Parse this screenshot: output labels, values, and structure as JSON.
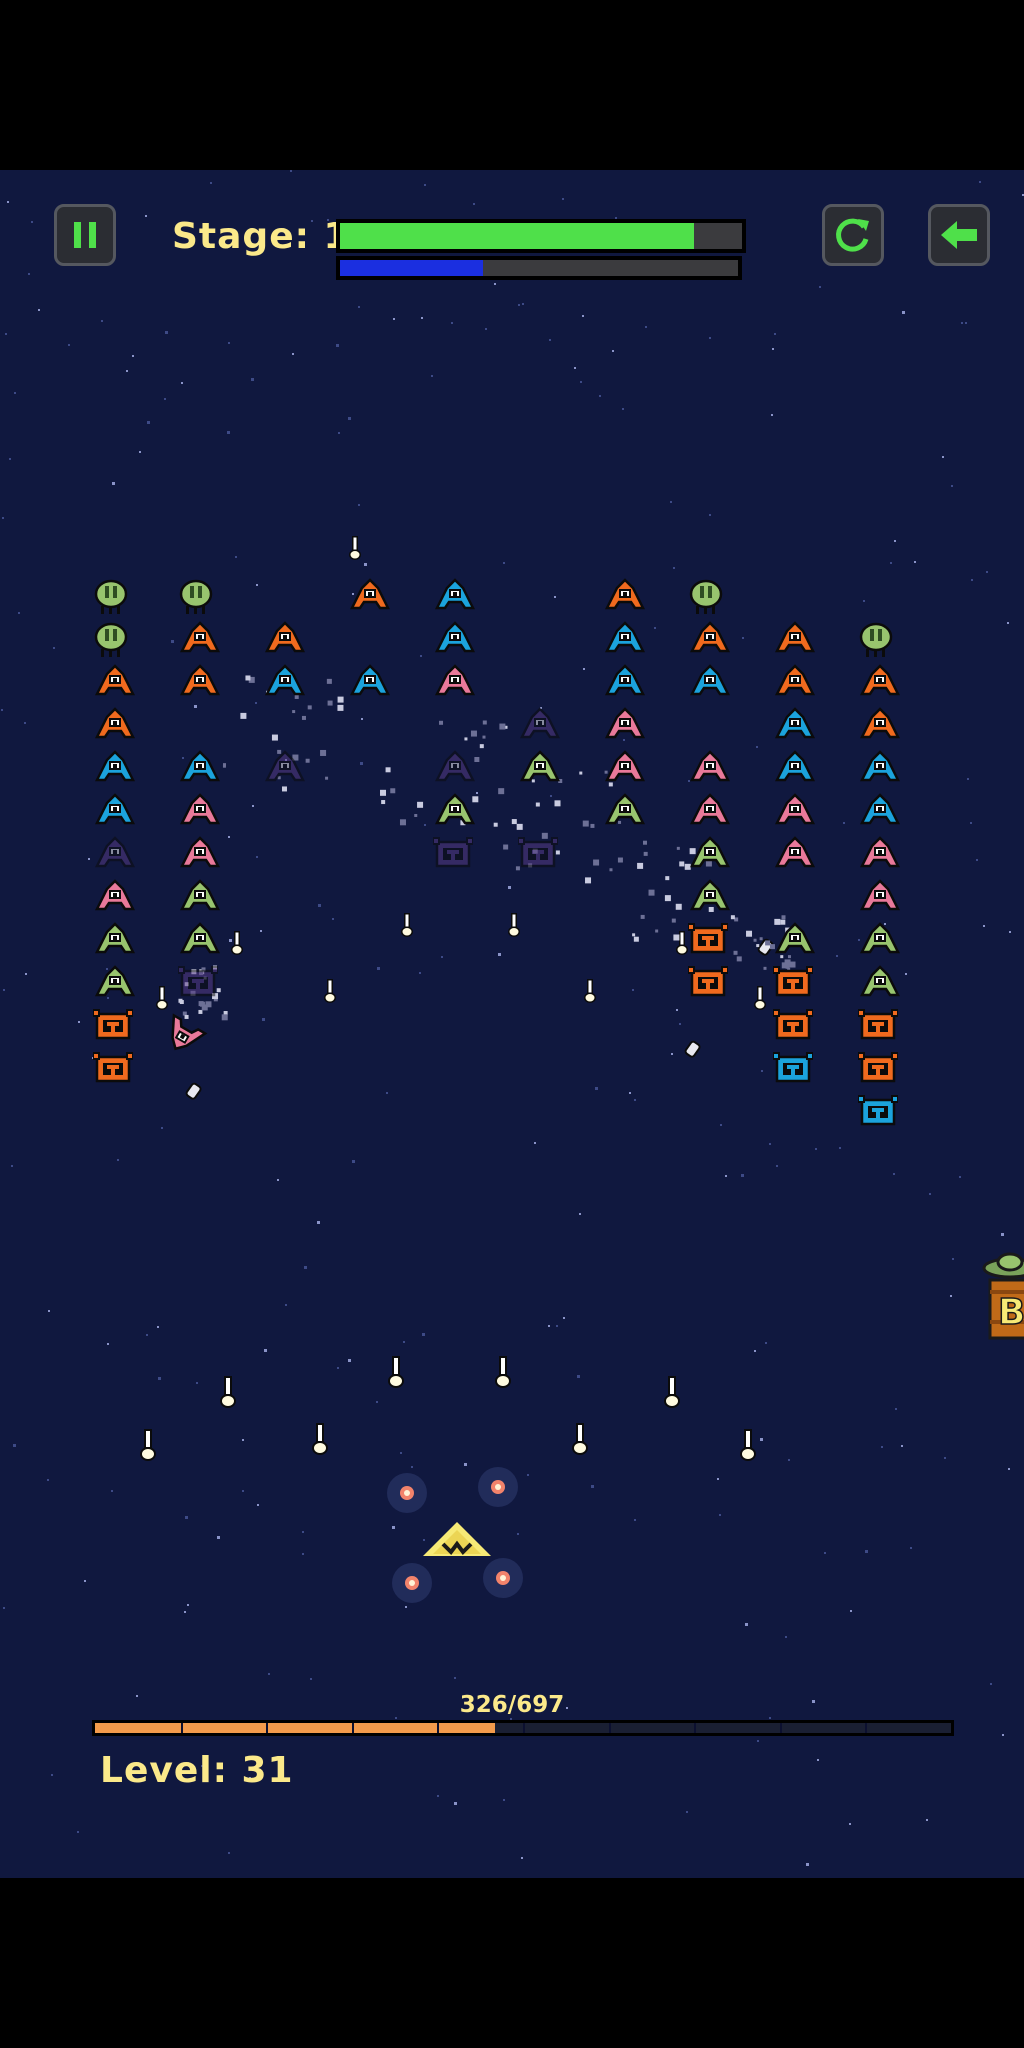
{
  "hud": {
    "stage_label": "Stage: 19",
    "health_fraction": 0.88,
    "energy_fraction": 0.36,
    "pause_icon": "pause-icon",
    "restart_icon": "restart-icon",
    "back_icon": "back-arrow-icon"
  },
  "experience": {
    "text": "326/697",
    "current": 326,
    "max": 697,
    "segments": 10
  },
  "level": {
    "label": "Level: 31"
  },
  "colors": {
    "background": "#10183f",
    "orange": "#f06a1e",
    "blue": "#1ba3dc",
    "pink": "#e9799a",
    "green": "#98c46e",
    "faded": "#5a3d8a",
    "player": "#f7ea76",
    "text": "#fbe98a"
  },
  "pickups": {
    "side_letter": "B"
  }
}
